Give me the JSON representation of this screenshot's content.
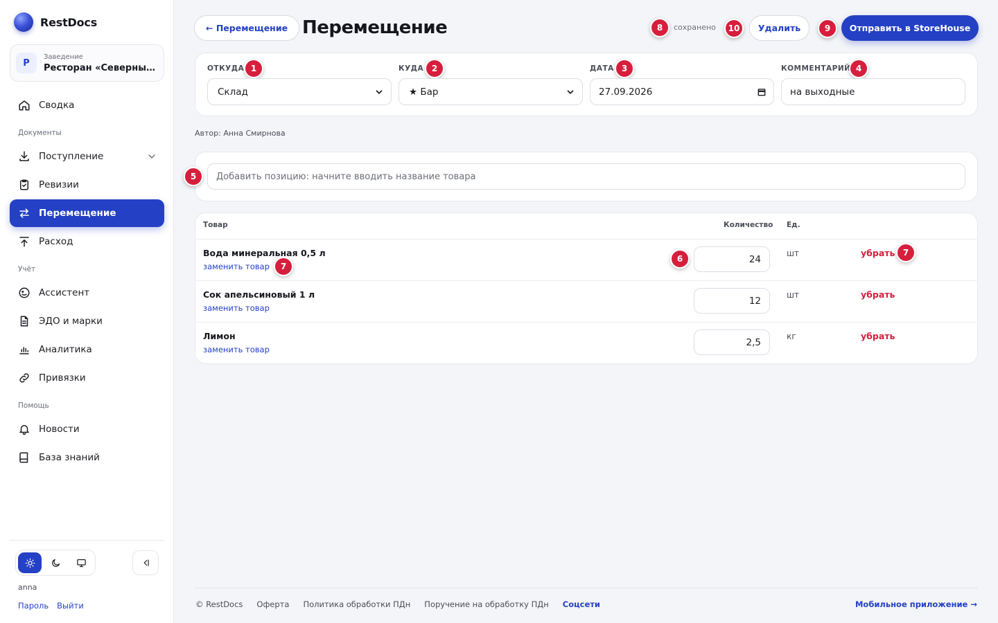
{
  "brand": {
    "name": "RestDocs"
  },
  "venue": {
    "initial": "Р",
    "caption": "Заведение",
    "name": "Ресторан «Северный двор»"
  },
  "nav": {
    "summary": "Сводка",
    "section_documents": "Документы",
    "receipts": "Поступление",
    "revisions": "Ревизии",
    "transfer": "Перемещение",
    "expense": "Расход",
    "section_accounting": "Учёт",
    "assistant": "Ассистент",
    "edo": "ЭДО и марки",
    "analytics": "Аналитика",
    "bindings": "Привязки",
    "section_help": "Помощь",
    "news": "Новости",
    "knowledge": "База знаний"
  },
  "user": {
    "name": "anna",
    "password_link": "Пароль",
    "logout_link": "Выйти"
  },
  "header": {
    "back_label": "← Перемещение",
    "title": "Перемещение",
    "saved_status": "сохранено",
    "delete_label": "Удалить",
    "send_label": "Отправить в StoreHouse"
  },
  "form": {
    "from_label": "ОТКУДА",
    "from_value": "Склад",
    "to_label": "КУДА",
    "to_value": "★ Бар",
    "date_label": "ДАТА",
    "date_value": "27.09.2026",
    "comment_label": "КОММЕНТАРИЙ",
    "comment_value": "на выходные"
  },
  "author": "Автор: Анна Смирнова",
  "add_item": {
    "placeholder": "Добавить позицию: начните вводить название товара"
  },
  "table": {
    "col_item": "Товар",
    "col_qty": "Количество",
    "col_unit": "Ед.",
    "rows": [
      {
        "name": "Вода минеральная 0,5 л",
        "replace": "заменить товар",
        "qty": "24",
        "unit": "шт",
        "remove": "убрать"
      },
      {
        "name": "Сок апельсиновый 1 л",
        "replace": "заменить товар",
        "qty": "12",
        "unit": "шт",
        "remove": "убрать"
      },
      {
        "name": "Лимон",
        "replace": "заменить товар",
        "qty": "2,5",
        "unit": "кг",
        "remove": "убрать"
      }
    ]
  },
  "markers": {
    "m1": "1",
    "m2": "2",
    "m3": "3",
    "m4": "4",
    "m5": "5",
    "m6": "6",
    "m7a": "7",
    "m7b": "7",
    "m8": "8",
    "m9": "9",
    "m10": "10"
  },
  "footer": {
    "copyright": "© RestDocs",
    "offer": "Оферта",
    "policy": "Политика обработки ПДн",
    "instruction": "Поручение на обработку ПДн",
    "social": "Соцсети",
    "mobile": "Мобильное приложение →"
  },
  "colors": {
    "accent": "#2440c4",
    "danger": "#d21f3c",
    "marker": "#d61f3d"
  }
}
